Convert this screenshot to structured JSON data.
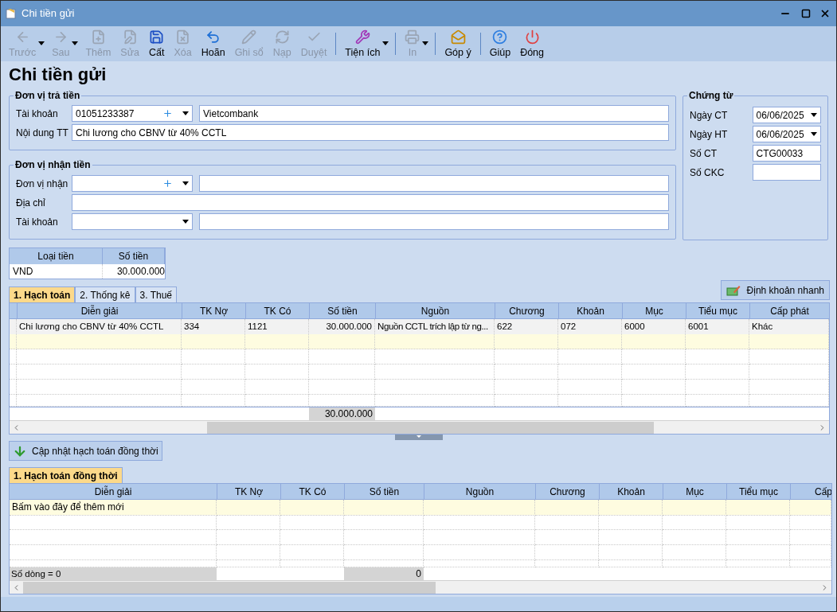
{
  "window": {
    "title": "Chi tiền gửi"
  },
  "toolbar": {
    "groups": [
      [
        {
          "label": "Trước",
          "disabled": true,
          "dropdown": true
        },
        {
          "label": "Sau",
          "disabled": true,
          "dropdown": true
        },
        {
          "label": "Thêm",
          "disabled": true,
          "dropdown": false
        },
        {
          "label": "Sửa",
          "disabled": true,
          "dropdown": false
        },
        {
          "label": "Cất",
          "disabled": false,
          "dropdown": false
        },
        {
          "label": "Xóa",
          "disabled": true,
          "dropdown": false
        },
        {
          "label": "Hoãn",
          "disabled": false,
          "dropdown": false
        },
        {
          "label": "Ghi sổ",
          "disabled": true,
          "dropdown": false
        },
        {
          "label": "Nạp",
          "disabled": true,
          "dropdown": false
        },
        {
          "label": "Duyệt",
          "disabled": true,
          "dropdown": false
        }
      ],
      [
        {
          "label": "Tiện ích",
          "disabled": false,
          "dropdown": true
        }
      ],
      [
        {
          "label": "In",
          "disabled": true,
          "dropdown": true
        }
      ],
      [
        {
          "label": "Góp ý",
          "disabled": false,
          "dropdown": false
        }
      ],
      [
        {
          "label": "Giúp",
          "disabled": false,
          "dropdown": false
        },
        {
          "label": "Đóng",
          "disabled": false,
          "dropdown": false
        }
      ]
    ]
  },
  "heading": "Chi tiền gửi",
  "payer": {
    "title": "Đơn vị trả tiền",
    "account": {
      "label": "Tài khoản",
      "value": "01051233387",
      "name": "Vietcombank"
    },
    "content": {
      "label": "Nội dung TT",
      "value": "Chi lương cho CBNV từ 40% CCTL"
    }
  },
  "payee": {
    "title": "Đơn vị nhận tiền",
    "unit": {
      "label": "Đơn vị nhận"
    },
    "address": {
      "label": "Địa chỉ"
    },
    "account": {
      "label": "Tài khoản"
    }
  },
  "voucher": {
    "title": "Chứng từ",
    "fields": [
      {
        "kind": "date",
        "label": "Ngày CT",
        "value": "06/06/2025"
      },
      {
        "kind": "date",
        "label": "Ngày HT",
        "value": "06/06/2025"
      },
      {
        "kind": "text",
        "label": "Số CT",
        "value": "CTG00033"
      },
      {
        "kind": "text",
        "label": "Số CKC"
      }
    ]
  },
  "currency_table": {
    "columns": [
      "Loại tiền",
      "Số tiền"
    ],
    "rows": [
      [
        "VND",
        "30.000.000"
      ]
    ]
  },
  "quick_entry_button": "Định khoản nhanh",
  "tabs": [
    {
      "label": "1. Hạch toán",
      "selected": true
    },
    {
      "label": "2. Thống kê",
      "selected": false
    },
    {
      "label": "3. Thuế",
      "selected": false
    }
  ],
  "entries_grid": {
    "columns": [
      "Diễn giải",
      "TK Nợ",
      "TK Có",
      "Số tiền",
      "Nguồn",
      "Chương",
      "Khoản",
      "Mục",
      "Tiểu mục",
      "Cấp phát"
    ],
    "rows": [
      {
        "selected": true,
        "cells": [
          "Chi lương cho CBNV từ 40% CCTL",
          "334",
          "1121",
          "30.000.000",
          "Nguồn CCTL trích lập từ ng...",
          "622",
          "072",
          "6000",
          "6001",
          "Khác"
        ]
      }
    ],
    "total": "30.000.000"
  },
  "update_button": "Cập nhật hạch toán đồng thời",
  "concurrent_tabs": [
    {
      "label": "1. Hạch toán đồng thời",
      "selected": true
    }
  ],
  "concurrent_grid": {
    "columns": [
      "Diễn giải",
      "TK Nợ",
      "TK Có",
      "Số tiền",
      "Nguồn",
      "Chương",
      "Khoản",
      "Mục",
      "Tiểu mục",
      "Cấp"
    ],
    "new_row_hint": "Bấm vào đây để thêm mới",
    "row_count": "Số dòng = 0",
    "total": "0"
  }
}
